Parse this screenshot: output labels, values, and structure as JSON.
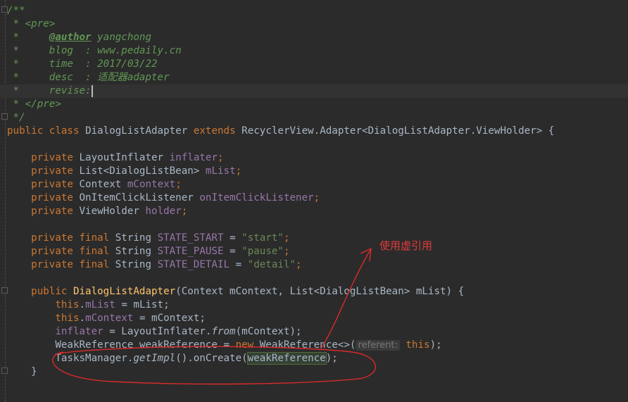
{
  "doc_comment": {
    "open": "/**",
    "pre_open": "<pre>",
    "author_tag": "@author",
    "author_value": "yangchong",
    "blog_key": "blog",
    "blog_value": "www.pedaily.cn",
    "time_key": "time",
    "time_value": "2017/03/22",
    "desc_key": "desc",
    "desc_value": "适配器adapter",
    "revise_key": "revise:",
    "pre_close": "</pre>",
    "close": "*/"
  },
  "class_decl": {
    "public": "public",
    "class": "class",
    "name": "DialogListAdapter",
    "extends": "extends",
    "superclass": "RecyclerView.Adapter<DialogListAdapter.ViewHolder> {"
  },
  "fields": [
    {
      "modifier": "private",
      "type": "LayoutInflater",
      "name": "inflater"
    },
    {
      "modifier": "private",
      "type": "List<DialogListBean>",
      "name": "mList"
    },
    {
      "modifier": "private",
      "type": "Context",
      "name": "mContext"
    },
    {
      "modifier": "private",
      "type": "OnItemClickListener",
      "name": "onItemClickListener"
    },
    {
      "modifier": "private",
      "type": "ViewHolder",
      "name": "holder"
    }
  ],
  "constants": [
    {
      "modifier": "private final",
      "type": "String",
      "name": "STATE_START",
      "value": "\"start\""
    },
    {
      "modifier": "private final",
      "type": "String",
      "name": "STATE_PAUSE",
      "value": "\"pause\""
    },
    {
      "modifier": "private final",
      "type": "String",
      "name": "STATE_DETAIL",
      "value": "\"detail\""
    }
  ],
  "constructor": {
    "modifier": "public",
    "name": "DialogListAdapter",
    "params": "(Context mContext, List<DialogListBean> mList) {",
    "body": {
      "l1_this": "this",
      "l1_field": "mList",
      "l1_rest": " = mList;",
      "l2_this": "this",
      "l2_field": "mContext",
      "l2_rest": " = mContext;",
      "l3_field": "inflater",
      "l3_mid": " = LayoutInflater.",
      "l3_call": "from",
      "l3_rest": "(mContext);",
      "l4_a": "WeakReference weakReference = ",
      "l4_new": "new",
      "l4_b": " WeakReference<>(",
      "l4_hint_name": "referent:",
      "l4_hint_this": "this",
      "l4_c": ");",
      "l5_a": "TasksManager.",
      "l5_call": "getImpl",
      "l5_b": "().onCreate(",
      "l5_arg": "weakReference",
      "l5_c": ");"
    },
    "close": "}"
  },
  "annotation": {
    "text": "使用虚引用",
    "color": "#e23b3b"
  }
}
